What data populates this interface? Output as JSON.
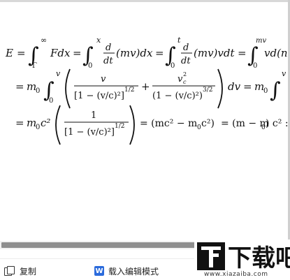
{
  "equation": {
    "line1": {
      "lhs": "E",
      "eq": "=",
      "int1_upper": "∞",
      "int1_lower": "Γ",
      "int1_body": "Fdx",
      "int2_upper": "x",
      "int2_lower": "0",
      "d": "d",
      "dt": "dt",
      "mv": "(mv)dx",
      "int3_upper": "t",
      "int3_lower": "0",
      "mv2": "(mv)vdt",
      "int4_upper": "mv",
      "int4_lower": "0",
      "tail": "vd(n"
    },
    "line2": {
      "eq": "=",
      "m0": "m",
      "sub0": "0",
      "int_upper": "v",
      "int_lower": "0",
      "num1": "v",
      "den1": "[1 − (v/c)²]",
      "den1_exp": "1/2",
      "plus": "+",
      "num2": "v",
      "num2_sup": "2",
      "num2_sub": "c",
      "den2": "(1 − (v/c)²)",
      "den2_exp": "3/2",
      "dv": "dv",
      "m0b": "m",
      "sub0b": "0",
      "int2_upper": "v"
    },
    "line3": {
      "eq": "=",
      "m0c2": "m",
      "sub0": "0",
      "c2": "c²",
      "num": "1",
      "den": "[1 − (v/c)²]",
      "den_exp": "1/2",
      "part1": "= (mc² − m",
      "part1_sub": "0",
      "part1_end": "c²)",
      "part2": "= (m − m",
      "part2_sub": "0",
      "part2_end": ") c² :"
    }
  },
  "toolbar": {
    "copy_label": "复制",
    "edit_label": "载入编辑模式",
    "word_icon_letter": "W"
  },
  "watermark": {
    "logo_text": "下载吧",
    "url": "www.xiazaiba.com"
  },
  "icons": {
    "copy": "copy-icon",
    "word": "word-icon"
  },
  "scroll": {
    "thumb_fraction": 0.68
  }
}
